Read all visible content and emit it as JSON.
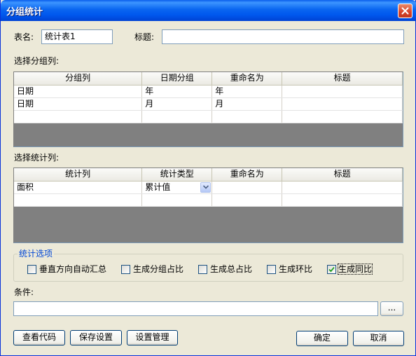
{
  "window": {
    "title": "分组统计"
  },
  "form": {
    "table_name_label": "表名:",
    "table_name_value": "统计表1",
    "title_label": "标题:",
    "title_value": ""
  },
  "group_section": {
    "label": "选择分组列:",
    "columns": [
      "分组列",
      "日期分组",
      "重命名为",
      "标题"
    ],
    "rows": [
      [
        "日期",
        "年",
        "年",
        ""
      ],
      [
        "日期",
        "月",
        "月",
        ""
      ]
    ]
  },
  "stat_section": {
    "label": "选择统计列:",
    "columns": [
      "统计列",
      "统计类型",
      "重命名为",
      "标题"
    ],
    "rows": [
      [
        "面积",
        "累计值",
        "",
        ""
      ]
    ]
  },
  "options": {
    "title": "统计选项",
    "items": [
      {
        "label": "垂直方向自动汇总",
        "checked": false
      },
      {
        "label": "生成分组占比",
        "checked": false
      },
      {
        "label": "生成总占比",
        "checked": false
      },
      {
        "label": "生成环比",
        "checked": false
      },
      {
        "label": "生成同比",
        "checked": true
      }
    ]
  },
  "condition": {
    "label": "条件:",
    "value": "",
    "browse_label": "..."
  },
  "buttons": {
    "view_code": "查看代码",
    "save_settings": "保存设置",
    "settings_manage": "设置管理",
    "ok": "确定",
    "cancel": "取消"
  },
  "colors": {
    "title_bar": "#0058EE",
    "dialog_bg": "#ECE9D8",
    "grid_empty": "#808080",
    "group_title": "#0046D5",
    "checkmark": "#21A121"
  }
}
